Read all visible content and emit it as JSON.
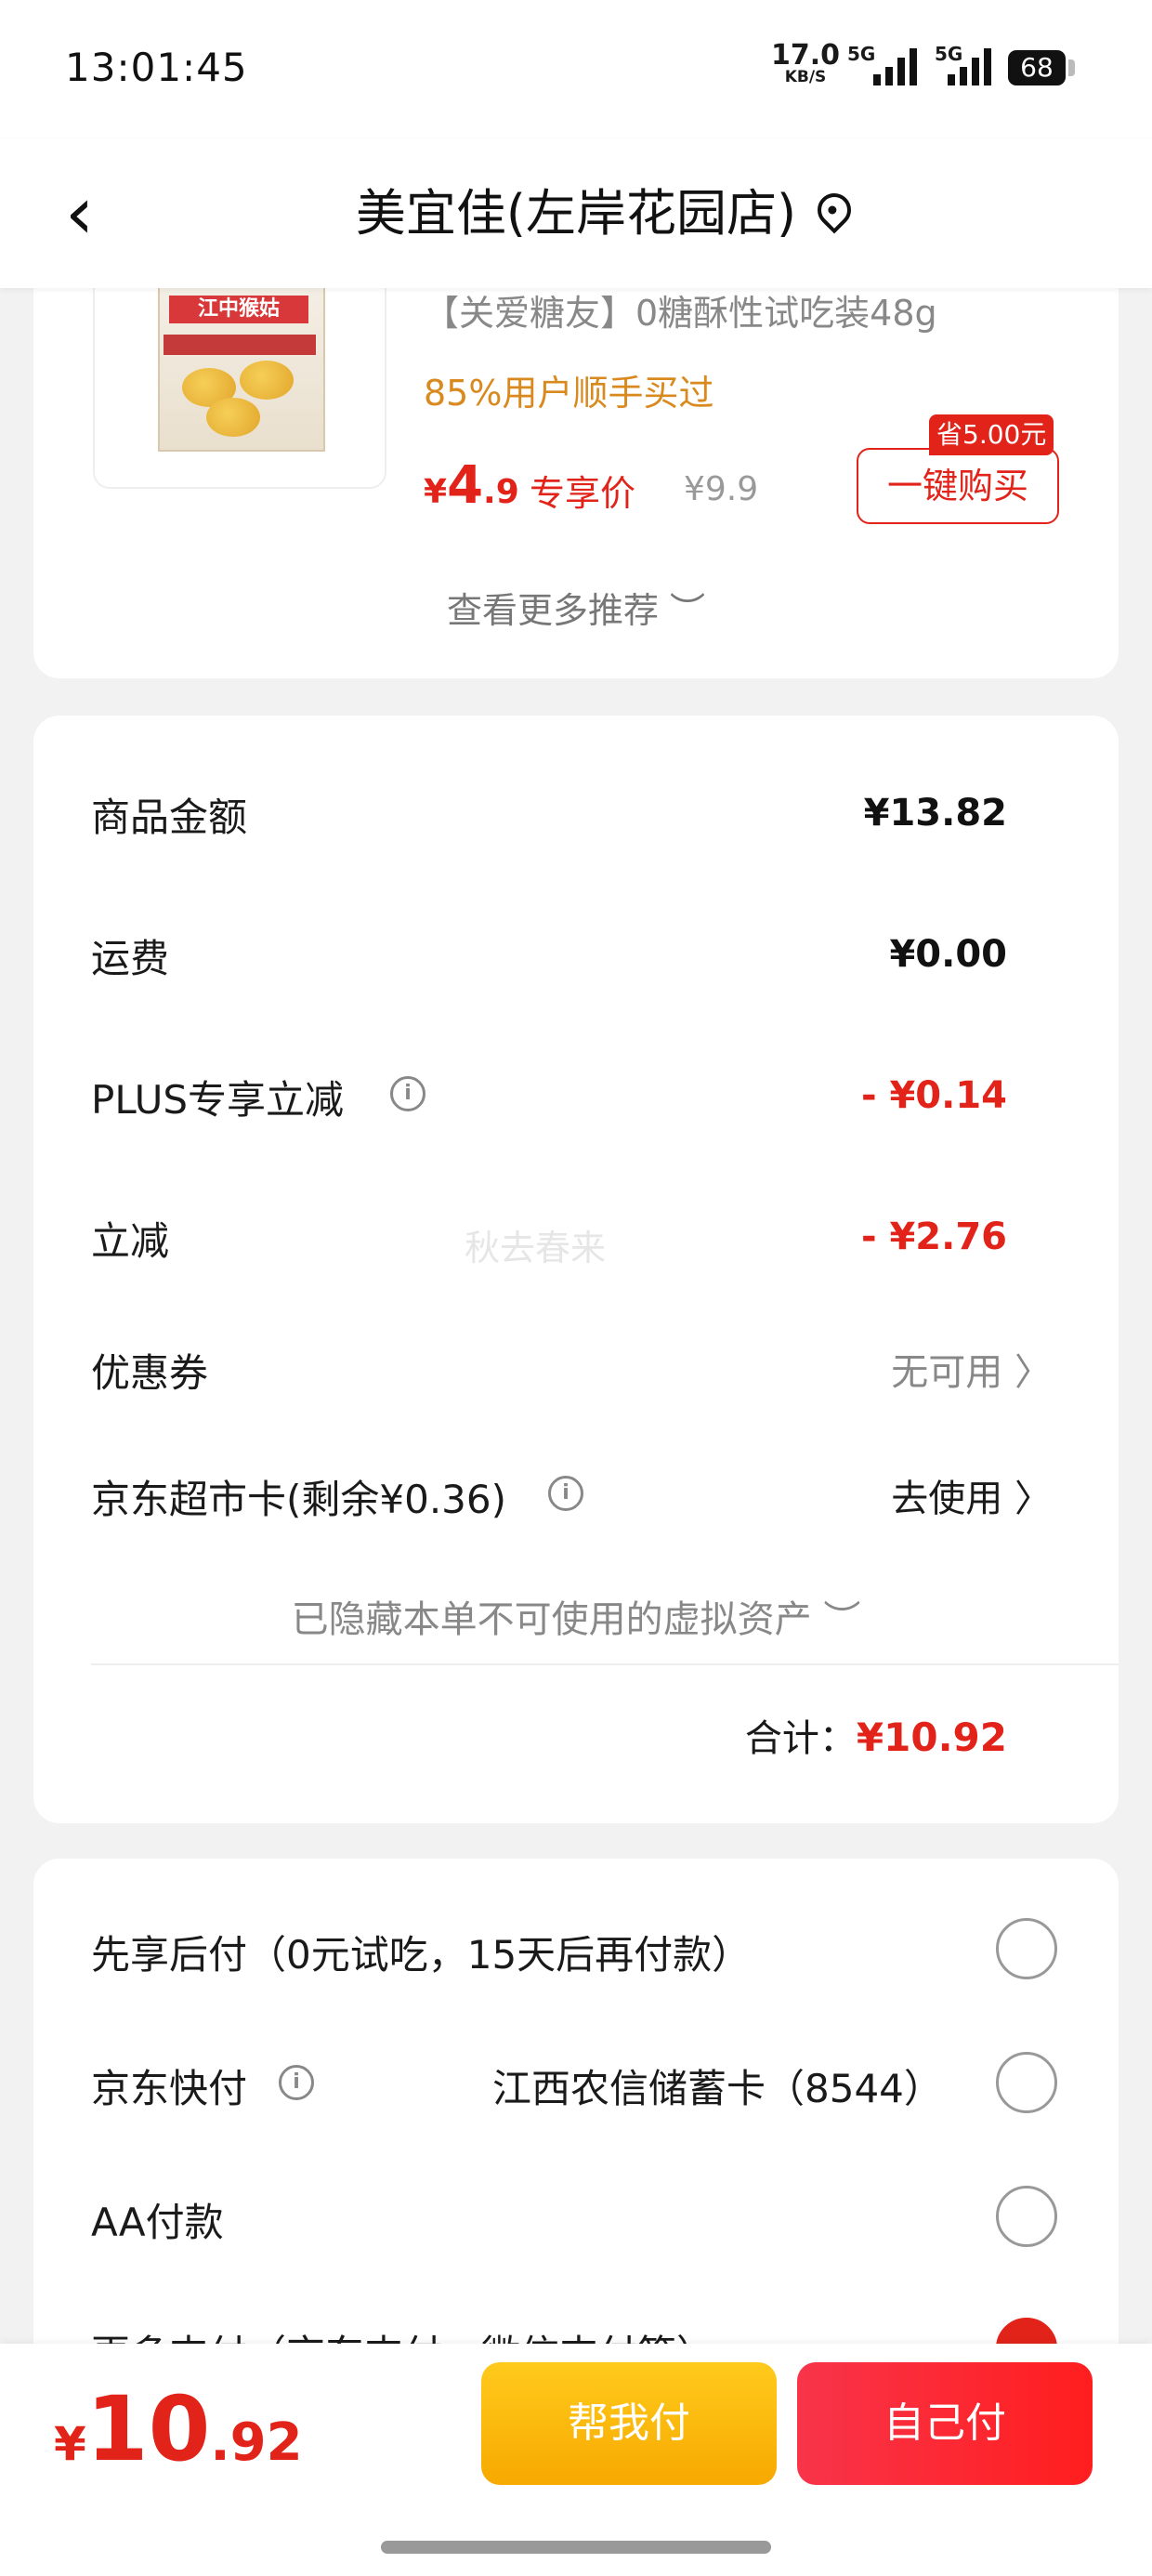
{
  "status_bar": {
    "time": "13:01:45",
    "net_speed": "17.0",
    "net_unit": "KB/S",
    "sim1": "5G",
    "sim2": "5G",
    "battery": "68"
  },
  "nav": {
    "title": "美宜佳(左岸花园店)"
  },
  "recommend": {
    "product_title": "【关爱糖友】0糖酥性试吃装48g",
    "bought_note": "85%用户顺手买过",
    "price_symbol": "¥",
    "price_int": "4",
    "price_dec": ".9",
    "price_tag": "专享价",
    "original_price": "¥9.9",
    "save_badge": "省5.00元",
    "buy_button": "一键购买",
    "box_brand": "江中猴姑",
    "more_label": "查看更多推荐 ︶"
  },
  "summary": {
    "rows": [
      {
        "label": "商品金额",
        "value": "¥13.82"
      },
      {
        "label": "运费",
        "value": "¥0.00"
      },
      {
        "label": "PLUS专享立减",
        "value": "- ¥0.14"
      },
      {
        "label": "立减",
        "value": "- ¥2.76"
      },
      {
        "label": "优惠券",
        "value": "无可用 〉"
      },
      {
        "label": "京东超市卡(剩余¥0.36)",
        "value": "去使用 〉"
      }
    ],
    "info_glyph": "i",
    "watermark": "秋去春来",
    "hidden_assets": "已隐藏本单不可使用的虚拟资产 ︶",
    "total_label": "合计：",
    "total_value": "¥10.92"
  },
  "payment": {
    "options": [
      {
        "label": "先享后付（0元试吃，15天后再付款）"
      },
      {
        "label": "京东快付",
        "detail": "江西农信储蓄卡（8544）"
      },
      {
        "label": "AA付款"
      },
      {
        "label": "更多支付（京东支付、微信支付等）"
      }
    ],
    "selected_index": 3
  },
  "bottom_bar": {
    "price_symbol": "¥",
    "price_int": "10",
    "price_dec": ".92",
    "help_pay": "帮我付",
    "self_pay": "自己付"
  },
  "colors": {
    "accent": "#e2231a",
    "orange_note": "#d98a1f",
    "help_button": "#f7a900"
  }
}
